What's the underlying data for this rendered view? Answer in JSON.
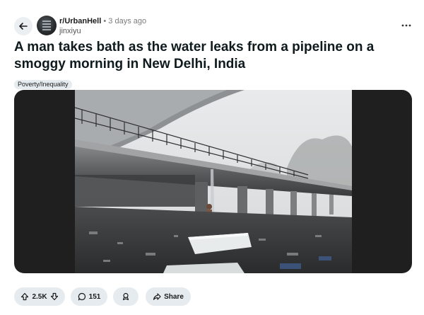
{
  "post": {
    "subreddit": "r/UrbanHell",
    "separator": "•",
    "time": "3 days ago",
    "author": "jinxiyu",
    "title": "A man takes bath as the water leaks from a pipeline on a smoggy morning in New Delhi, India",
    "flair": "Poverty/Inequality"
  },
  "actions": {
    "vote_count": "2.5K",
    "comment_count": "151",
    "share_label": "Share"
  },
  "icons": {
    "back": "arrow-left-icon",
    "more": "more-horizontal-icon",
    "upvote": "upvote-arrow-icon",
    "downvote": "downvote-arrow-icon",
    "comment": "comment-bubble-icon",
    "award": "award-icon",
    "share": "share-arrow-icon"
  },
  "colors": {
    "pill_bg": "#e5ebee",
    "media_bg": "#1f1f1f"
  }
}
